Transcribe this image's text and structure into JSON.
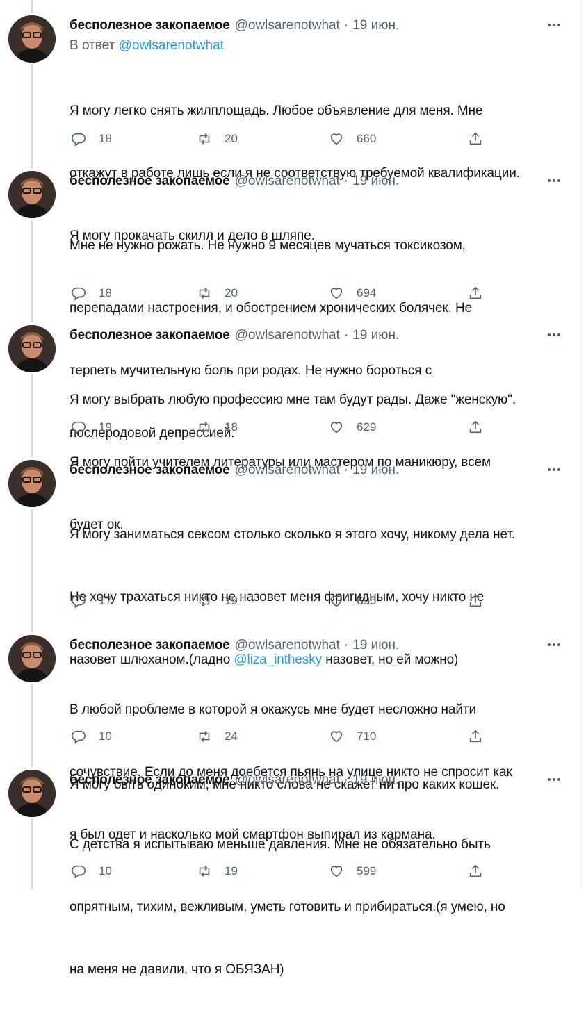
{
  "author": {
    "name": "бесполезное закопаемое",
    "handle": "@owlsarenotwhat",
    "separator": "·"
  },
  "icons": {
    "reply": "reply-icon",
    "retweet": "retweet-icon",
    "like": "heart-icon",
    "share": "share-icon",
    "more": "more-icon"
  },
  "colors": {
    "link": "#1d9bf0",
    "secondary": "#536471",
    "thread_line": "#cfd9de"
  },
  "tweets": [
    {
      "date": "19 июн.",
      "reply_to_prefix": "В ответ",
      "reply_to_handle": "@owlsarenotwhat",
      "text_lines": [
        "Я могу легко снять жилплощадь. Любое объявление для меня. Мне",
        "откажут в работе лишь если я не соответствую требуемой квалификации.",
        "Я могу прокачать скилл и дело в шляпе."
      ],
      "replies": "18",
      "retweets": "20",
      "likes": "660"
    },
    {
      "date": "19 июн.",
      "text_lines": [
        "Мне не нужно рожать. Не нужно 9 месяцев мучаться токсикозом,",
        "перепадами настроения, и обострением хронических болячек. Не",
        "терпеть мучительную боль при родах. Не нужно бороться с",
        "послеродовой депрессией."
      ],
      "replies": "18",
      "retweets": "20",
      "likes": "694"
    },
    {
      "date": "19 июн.",
      "text_lines": [
        "Я могу выбрать любую профессию мне там будут рады. Даже \"женскую\".",
        "Я могу пойти учителем литературы или мастером по маникюру, всем",
        "будет ок."
      ],
      "replies": "19",
      "retweets": "18",
      "likes": "629"
    },
    {
      "date": "19 июн.",
      "text_lines": [
        "Я могу заниматься сексом столько сколько я этого хочу, никому дела нет.",
        "Не хочу трахаться никто не назовет меня фригидным, хочу никто не"
      ],
      "line3_before": "назовет шлюханом.(ладно ",
      "line3_mention": "@liza_inthesky",
      "line3_after": " назовет, но ей можно)",
      "line5": "Я могу быть одиноким, мне никто слова не скажет ни про каких кошек.",
      "replies": "17",
      "retweets": "19",
      "likes": "695"
    },
    {
      "date": "19 июн.",
      "text_lines": [
        "В любой проблеме в которой я окажусь мне будет несложно найти",
        "сочувствие. Если до меня доебется пьянь на улице никто не спросит как",
        "я был одет и насколько мой смартфон выпирал из кармана."
      ],
      "replies": "10",
      "retweets": "24",
      "likes": "710"
    },
    {
      "date": "19 июн.",
      "text_lines": [
        "С детства я испытываю меньше давления. Мне не обязательно быть",
        "опрятным, тихим, вежливым, уметь готовить и прибираться.(я умею, но",
        "на меня не давили, что я ОБЯЗАН)"
      ],
      "replies": "10",
      "retweets": "19",
      "likes": "599"
    }
  ]
}
